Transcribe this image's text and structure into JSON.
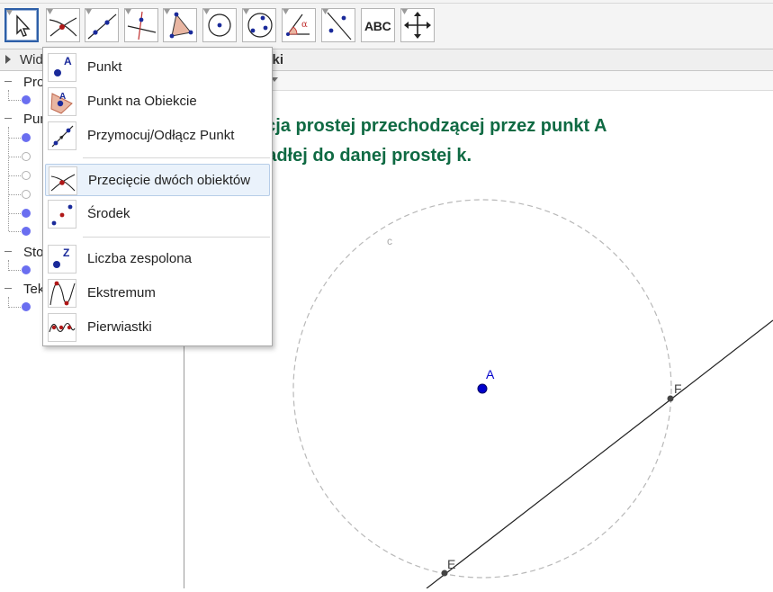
{
  "toolbar": {
    "tools": [
      {
        "name": "move-tool",
        "selected": true
      },
      {
        "name": "intersect-tool"
      },
      {
        "name": "line-tool"
      },
      {
        "name": "perpendicular-line-tool"
      },
      {
        "name": "polygon-tool"
      },
      {
        "name": "circle-center-point-tool"
      },
      {
        "name": "circle-three-points-tool"
      },
      {
        "name": "angle-tool"
      },
      {
        "name": "reflect-tool"
      },
      {
        "name": "text-tool",
        "label": "ABC"
      },
      {
        "name": "move-graphics-view-tool"
      }
    ]
  },
  "algebra": {
    "header_title": "Wid",
    "groups": [
      {
        "label": "Pro"
      },
      {
        "label": "Pun"
      },
      {
        "label": "Sto"
      },
      {
        "label": "Tek"
      }
    ]
  },
  "graphics": {
    "header_title": "afiki",
    "heading_line1": "kcja prostej przechodzącej przez punkt A",
    "heading_line2": "padłej do danej prostej k.",
    "labels": {
      "circle": "c",
      "point_a": "A",
      "point_e": "E",
      "point_f": "F"
    },
    "colors": {
      "heading": "#0f6a43",
      "point_a": "#0000cc",
      "circle": "#b8b8b8"
    }
  },
  "menu": {
    "items": [
      {
        "label": "Punkt",
        "icon": "point-icon"
      },
      {
        "label": "Punkt na Obiekcie",
        "icon": "point-on-object-icon"
      },
      {
        "label": "Przymocuj/Odłącz Punkt",
        "icon": "attach-detach-point-icon"
      },
      {
        "label": "Przecięcie dwóch obiektów",
        "icon": "intersection-icon",
        "highlighted": true
      },
      {
        "label": "Środek",
        "icon": "midpoint-icon"
      },
      {
        "label": "Liczba zespolona",
        "icon": "complex-number-icon"
      },
      {
        "label": "Ekstremum",
        "icon": "extremum-icon"
      },
      {
        "label": "Pierwiastki",
        "icon": "roots-icon"
      }
    ]
  }
}
